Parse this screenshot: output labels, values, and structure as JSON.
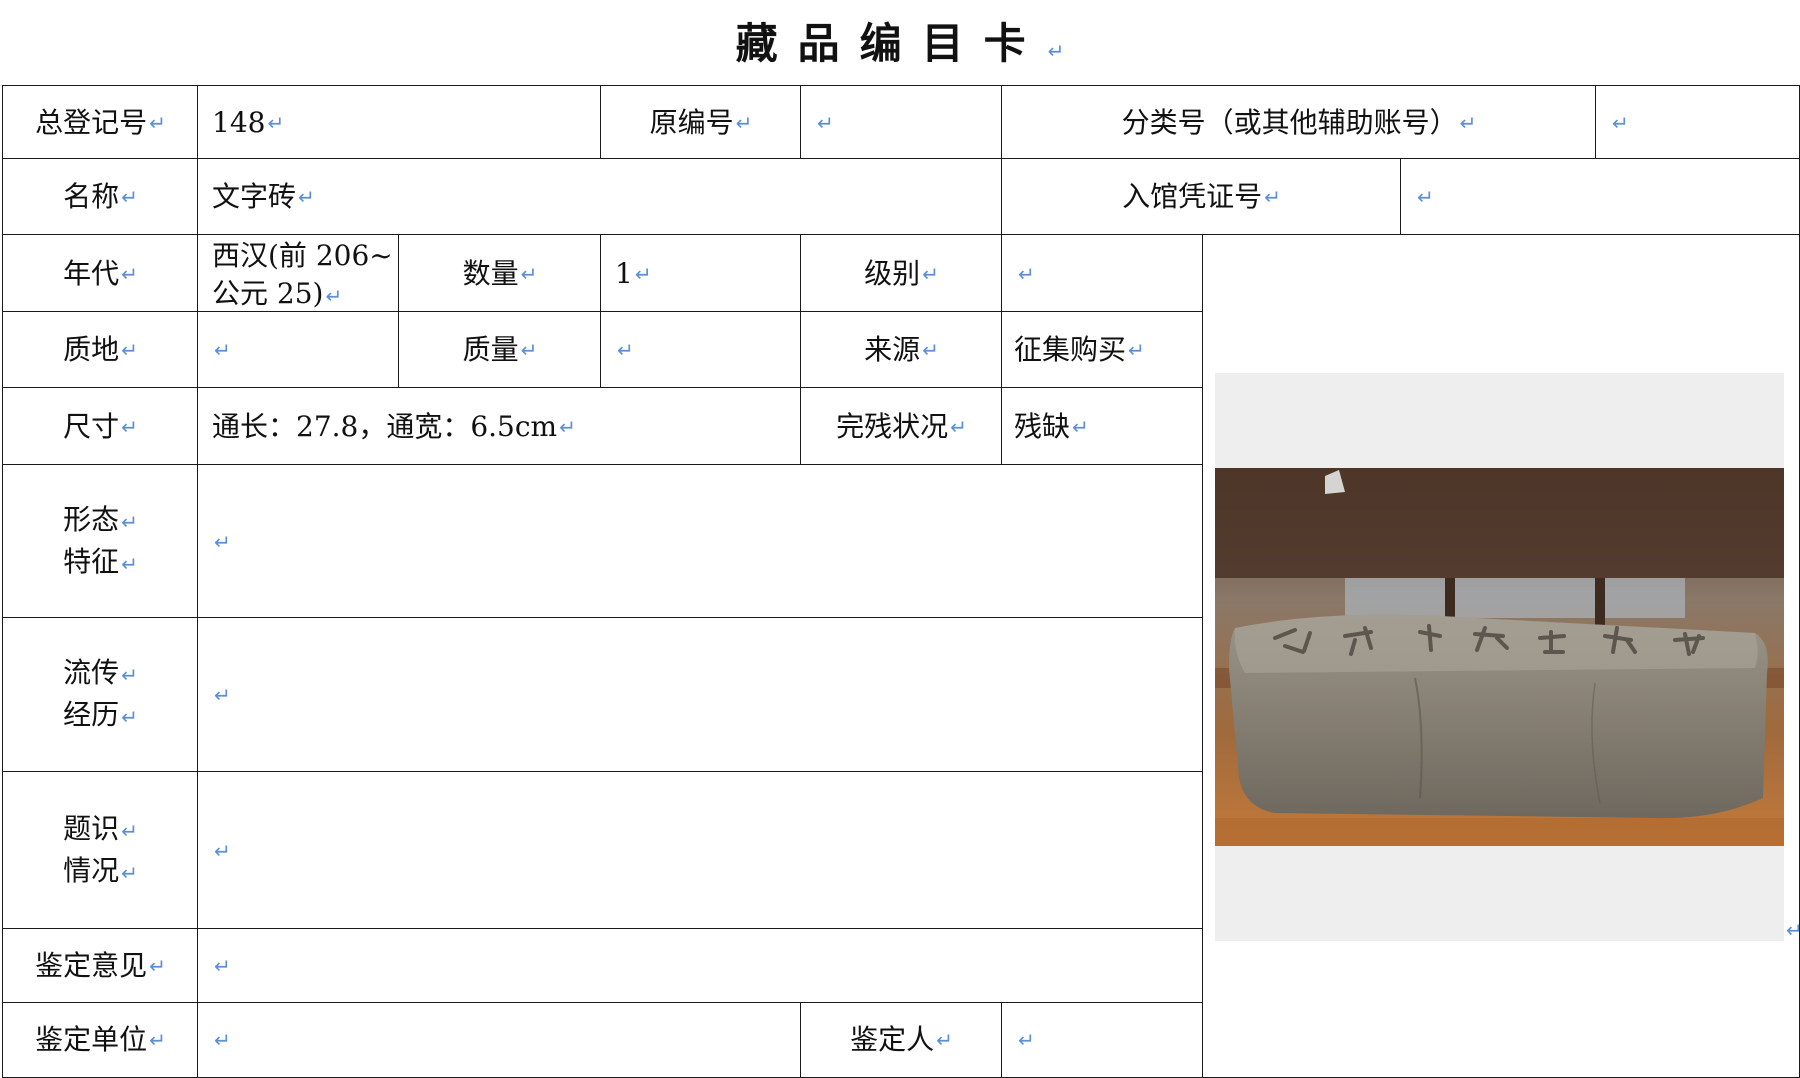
{
  "title": "藏品编目卡",
  "return_mark": "↵",
  "rows": {
    "r1": {
      "reg_label": "总登记号",
      "reg_value": "148",
      "orig_label": "原编号",
      "orig_value": "",
      "class_label": "分类号（或其他辅助账号）",
      "class_value": ""
    },
    "r2": {
      "name_label": "名称",
      "name_value": "文字砖",
      "voucher_label": "入馆凭证号",
      "voucher_value": ""
    },
    "r3": {
      "era_label": "年代",
      "era_value_line1": "西汉(前 206~",
      "era_value_line2": "公元 25)",
      "qty_label": "数量",
      "qty_value": "1",
      "grade_label": "级别",
      "grade_value": ""
    },
    "r4": {
      "material_label": "质地",
      "material_value": "",
      "weight_label": "质量",
      "weight_value": "",
      "source_label": "来源",
      "source_value": "征集购买"
    },
    "r5": {
      "size_label": "尺寸",
      "size_value": "通长：27.8，通宽：6.5cm",
      "condition_label": "完残状况",
      "condition_value": "残缺"
    },
    "r6": {
      "label_line1": "形态",
      "label_line2": "特征",
      "value": ""
    },
    "r7": {
      "label_line1": "流传",
      "label_line2": "经历",
      "value": ""
    },
    "r8": {
      "label_line1": "题识",
      "label_line2": "情况",
      "value": ""
    },
    "r9": {
      "label": "鉴定意见",
      "value": ""
    },
    "r10": {
      "unit_label": "鉴定单位",
      "unit_value": "",
      "person_label": "鉴定人",
      "person_value": ""
    }
  },
  "photo": {
    "icon": "brick-photo-icon"
  }
}
